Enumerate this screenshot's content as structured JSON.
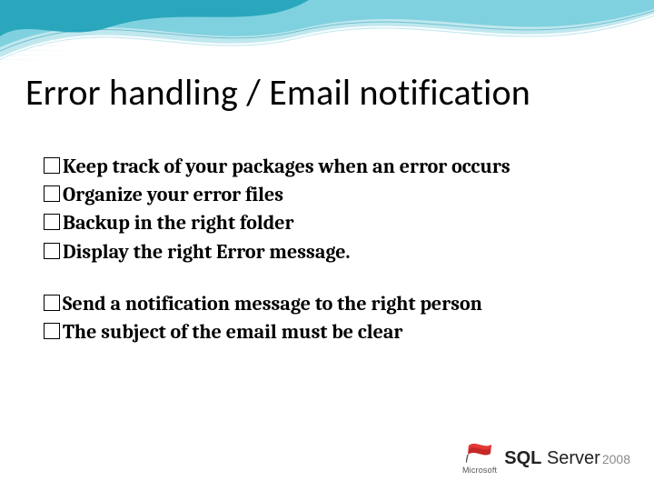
{
  "slide": {
    "title": "Error handling / Email notification",
    "group1": [
      "Keep track of your packages when an error occurs",
      "Organize your error files",
      "Backup in the right folder",
      "Display the right Error message."
    ],
    "group2": [
      "Send a notification message to the right person",
      "The subject of the email must be clear"
    ]
  },
  "logo": {
    "vendor": "Microsoft",
    "product_prefix": "SQL",
    "product_suffix": "Server",
    "year": "2008"
  },
  "colors": {
    "wave_outer": "#bfe7ee",
    "wave_mid": "#66c7d6",
    "wave_inner": "#1f9bb3",
    "wave_edge": "#ffffff"
  }
}
